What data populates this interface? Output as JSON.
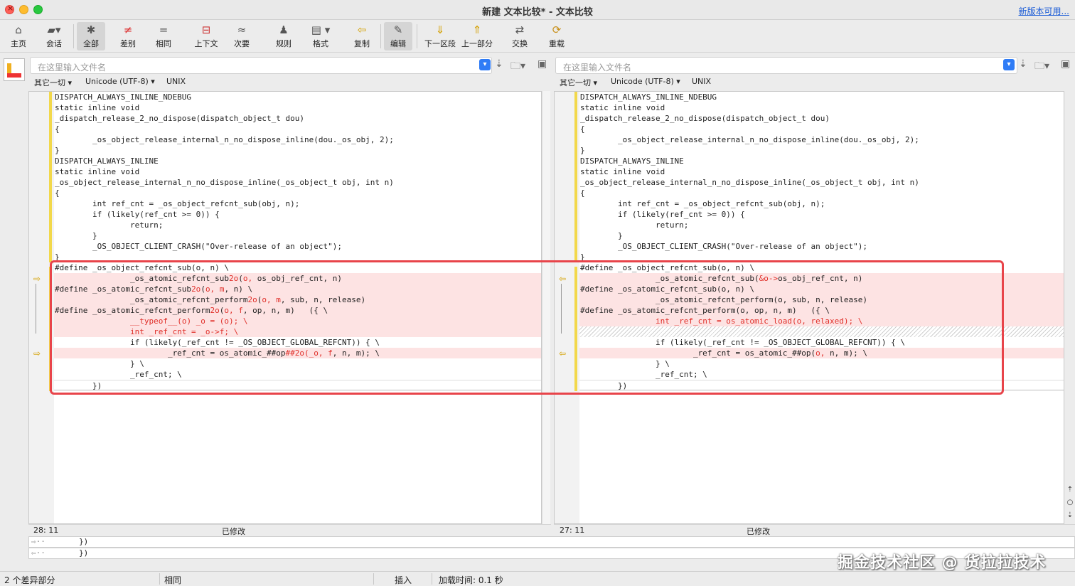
{
  "window": {
    "title": "新建 文本比较* - 文本比较",
    "update_link": "新版本可用..."
  },
  "toolbar": {
    "home": "主页",
    "session": "会话",
    "all": "全部",
    "diffs": "差别",
    "same": "相同",
    "context": "上下文",
    "minor": "次要",
    "rules": "规则",
    "format": "格式",
    "copy": "复制",
    "edit": "编辑",
    "next_section": "下一区段",
    "prev_part": "上一部分",
    "swap": "交换",
    "reload": "重载"
  },
  "left": {
    "placeholder": "在这里输入文件名",
    "other": "其它一切",
    "encoding": "Unicode (UTF-8)",
    "lineending": "UNIX",
    "position": "28: 11",
    "state": "已修改",
    "lines": [
      [
        {
          "t": "DISPATCH_ALWAYS_INLINE_NDEBUG"
        }
      ],
      [
        {
          "t": "static inline void"
        }
      ],
      [
        {
          "t": "_dispatch_release_2_no_dispose(dispatch_object_t dou)"
        }
      ],
      [
        {
          "t": "{"
        }
      ],
      [
        {
          "t": "        _os_object_release_internal_n_no_dispose_inline(dou._os_obj, 2);"
        }
      ],
      [
        {
          "t": "}"
        }
      ],
      [
        {
          "t": "DISPATCH_ALWAYS_INLINE"
        }
      ],
      [
        {
          "t": "static inline void"
        }
      ],
      [
        {
          "t": "_os_object_release_internal_n_no_dispose_inline(_os_object_t obj, int n)"
        }
      ],
      [
        {
          "t": "{"
        }
      ],
      [
        {
          "t": "        int ref_cnt = _os_object_refcnt_sub(obj, n);"
        }
      ],
      [
        {
          "t": "        if (likely(ref_cnt >= 0)) {"
        }
      ],
      [
        {
          "t": "                return;"
        }
      ],
      [
        {
          "t": "        }"
        }
      ],
      [
        {
          "t": "        _OS_OBJECT_CLIENT_CRASH(\"Over-release of an object\");"
        }
      ],
      [
        {
          "t": "}"
        }
      ],
      [
        {
          "t": "#define _os_object_refcnt_sub(o, n) \\"
        }
      ],
      [
        {
          "t": "                _os_atomic_refcnt_sub"
        },
        {
          "t": "2o",
          "r": 1
        },
        {
          "t": "("
        },
        {
          "t": "o,",
          "r": 1
        },
        {
          "t": " os_obj_ref_cnt, n)"
        }
      ],
      [
        {
          "t": "#define _os_atomic_refcnt_sub"
        },
        {
          "t": "2o",
          "r": 1
        },
        {
          "t": "("
        },
        {
          "t": "o,",
          "r": 1
        },
        {
          "t": " "
        },
        {
          "t": "m",
          "r": 1
        },
        {
          "t": ", n) \\"
        }
      ],
      [
        {
          "t": "                _os_atomic_refcnt_perform"
        },
        {
          "t": "2o",
          "r": 1
        },
        {
          "t": "("
        },
        {
          "t": "o,",
          "r": 1
        },
        {
          "t": " "
        },
        {
          "t": "m",
          "r": 1
        },
        {
          "t": ", sub, n, release)"
        }
      ],
      [
        {
          "t": "#define _os_atomic_refcnt_perform"
        },
        {
          "t": "2o",
          "r": 1
        },
        {
          "t": "("
        },
        {
          "t": "o,",
          "r": 1
        },
        {
          "t": " "
        },
        {
          "t": "f",
          "r": 1
        },
        {
          "t": ", op, n, m)   ({ \\"
        }
      ],
      [
        {
          "t": "                "
        },
        {
          "t": "__typeof__(o) _o = (o); \\",
          "r": 1
        }
      ],
      [
        {
          "t": "                "
        },
        {
          "t": "int _ref_cnt = _o->f; \\",
          "r": 1
        }
      ],
      [
        {
          "t": "                if (likely(_ref_cnt != _OS_OBJECT_GLOBAL_REFCNT)) { \\"
        }
      ],
      [
        {
          "t": "                        _ref_cnt = os_atomic_##op"
        },
        {
          "t": "##2o(_o, f",
          "r": 1
        },
        {
          "t": ", n, m); \\"
        }
      ],
      [
        {
          "t": "                } \\"
        }
      ],
      [
        {
          "t": "                _ref_cnt; \\"
        }
      ],
      [
        {
          "t": "        })"
        }
      ]
    ]
  },
  "right": {
    "placeholder": "在这里输入文件名",
    "other": "其它一切",
    "encoding": "Unicode (UTF-8)",
    "lineending": "UNIX",
    "position": "27: 11",
    "state": "已修改",
    "lines": [
      [
        {
          "t": "DISPATCH_ALWAYS_INLINE_NDEBUG"
        }
      ],
      [
        {
          "t": "static inline void"
        }
      ],
      [
        {
          "t": "_dispatch_release_2_no_dispose(dispatch_object_t dou)"
        }
      ],
      [
        {
          "t": "{"
        }
      ],
      [
        {
          "t": "        _os_object_release_internal_n_no_dispose_inline(dou._os_obj, 2);"
        }
      ],
      [
        {
          "t": "}"
        }
      ],
      [
        {
          "t": "DISPATCH_ALWAYS_INLINE"
        }
      ],
      [
        {
          "t": "static inline void"
        }
      ],
      [
        {
          "t": "_os_object_release_internal_n_no_dispose_inline(_os_object_t obj, int n)"
        }
      ],
      [
        {
          "t": "{"
        }
      ],
      [
        {
          "t": "        int ref_cnt = _os_object_refcnt_sub(obj, n);"
        }
      ],
      [
        {
          "t": "        if (likely(ref_cnt >= 0)) {"
        }
      ],
      [
        {
          "t": "                return;"
        }
      ],
      [
        {
          "t": "        }"
        }
      ],
      [
        {
          "t": "        _OS_OBJECT_CLIENT_CRASH(\"Over-release of an object\");"
        }
      ],
      [
        {
          "t": "}"
        }
      ],
      [
        {
          "t": "#define _os_object_refcnt_sub(o, n) \\"
        }
      ],
      [
        {
          "t": "                _os_atomic_refcnt_sub("
        },
        {
          "t": "&o->",
          "r": 1
        },
        {
          "t": "os_obj_ref_cnt, n)"
        }
      ],
      [
        {
          "t": "#define _os_atomic_refcnt_sub(o, n) \\"
        }
      ],
      [
        {
          "t": "                _os_atomic_refcnt_perform(o, sub, n, release)"
        }
      ],
      [
        {
          "t": "#define _os_atomic_refcnt_perform(o, op, n, m)   ({ \\"
        }
      ],
      [
        {
          "t": "                "
        },
        {
          "t": "int _ref_cnt = os_atomic_load(o, relaxed); \\",
          "r": 1
        }
      ],
      [],
      [
        {
          "t": "                if (likely(_ref_cnt != _OS_OBJECT_GLOBAL_REFCNT)) { \\"
        }
      ],
      [
        {
          "t": "                        _ref_cnt = os_atomic_##op("
        },
        {
          "t": "o,",
          "r": 1
        },
        {
          "t": " n, m); \\"
        }
      ],
      [
        {
          "t": "                } \\"
        }
      ],
      [
        {
          "t": "                _ref_cnt; \\"
        }
      ],
      [
        {
          "t": "        })"
        }
      ]
    ]
  },
  "compare": {
    "line1": "        })",
    "line2": "        })"
  },
  "status": {
    "diff_count": "2 个差异部分",
    "same": "相同",
    "insert": "插入",
    "load_time": "加载时间:  0.1 秒"
  },
  "watermark": "掘金技术社区 @ 货拉拉技术",
  "colors": {
    "diff_bg": "#fde3e3",
    "diff_text": "#e0302a",
    "highlight": "#e8444a",
    "changebar": "#f2d84b"
  }
}
